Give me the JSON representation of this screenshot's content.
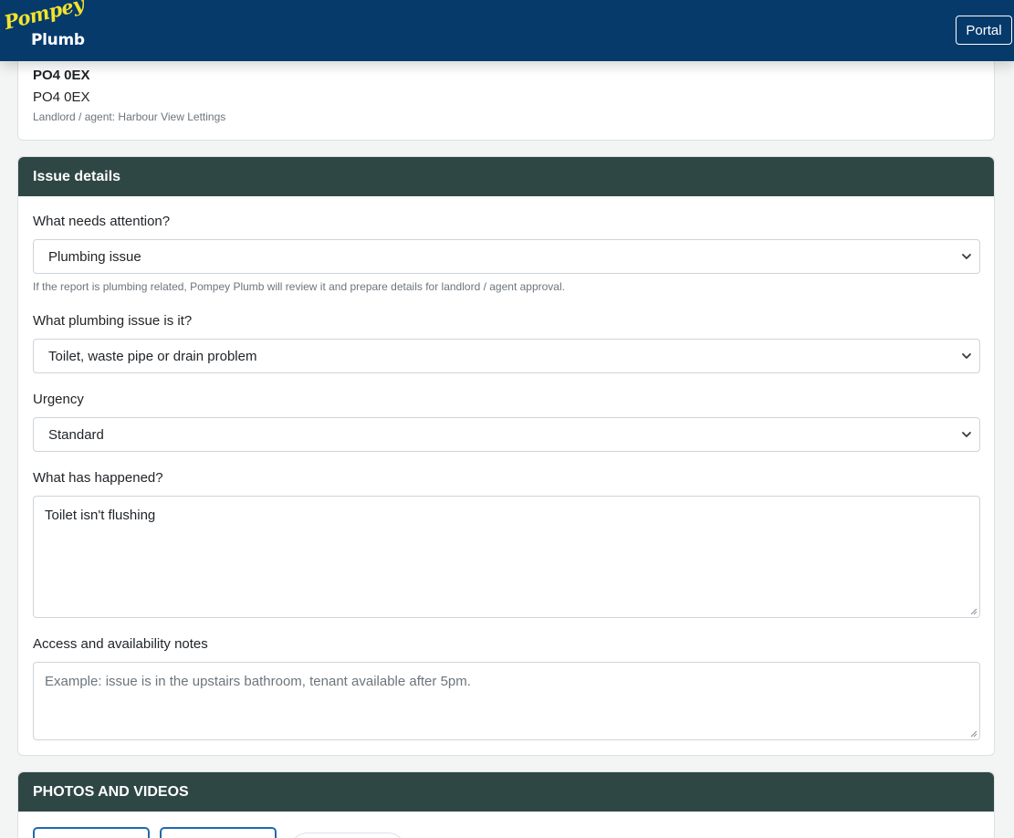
{
  "navbar": {
    "logo_line1": "Pompey",
    "logo_line2": "Plumb",
    "portal_label": "Portal"
  },
  "property": {
    "address_bold": "PO4 0EX",
    "address": "PO4 0EX",
    "landlord": "Landlord / agent: Harbour View Lettings"
  },
  "issue": {
    "header": "Issue details",
    "attention_label": "What needs attention?",
    "attention_value": "Plumbing issue",
    "attention_help": "If the report is plumbing related, Pompey Plumb will review it and prepare details for landlord / agent approval.",
    "plumbing_label": "What plumbing issue is it?",
    "plumbing_value": "Toilet, waste pipe or drain problem",
    "urgency_label": "Urgency",
    "urgency_value": "Standard",
    "happened_label": "What has happened?",
    "happened_value": "Toilet isn't flushing",
    "access_label": "Access and availability notes",
    "access_placeholder": "Example: issue is in the upstairs bathroom, tenant available after 5pm."
  },
  "photos": {
    "header": "PHOTOS AND VIDEOS"
  },
  "colors": {
    "navbar": "#053a6b",
    "card_header": "#2e4744",
    "logo_yellow": "#f4e32a",
    "button_outline": "#1f6ab0"
  }
}
